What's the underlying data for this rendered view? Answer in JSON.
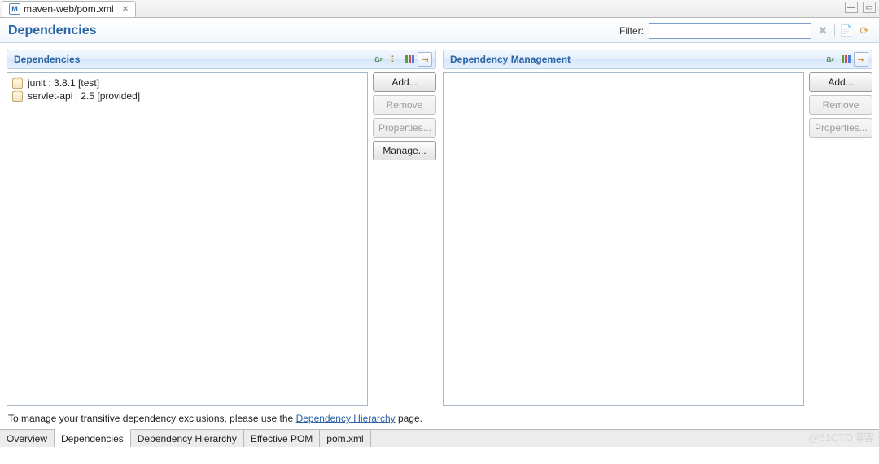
{
  "tab": {
    "title": "maven-web/pom.xml"
  },
  "page": {
    "title": "Dependencies"
  },
  "filter": {
    "label": "Filter:",
    "value": ""
  },
  "panels": {
    "left": {
      "title": "Dependencies",
      "items": [
        {
          "label": "junit : 3.8.1 [test]"
        },
        {
          "label": "servlet-api : 2.5 [provided]"
        }
      ],
      "buttons": {
        "add": "Add...",
        "remove": "Remove",
        "properties": "Properties...",
        "manage": "Manage..."
      }
    },
    "right": {
      "title": "Dependency Management",
      "items": [],
      "buttons": {
        "add": "Add...",
        "remove": "Remove",
        "properties": "Properties..."
      }
    }
  },
  "hint": {
    "prefix": "To manage your transitive dependency exclusions, please use the ",
    "link": "Dependency Hierarchy",
    "suffix": " page."
  },
  "editorTabs": [
    "Overview",
    "Dependencies",
    "Dependency Hierarchy",
    "Effective POM",
    "pom.xml"
  ],
  "activeEditorTab": 1,
  "watermark": "@51CTO博客"
}
